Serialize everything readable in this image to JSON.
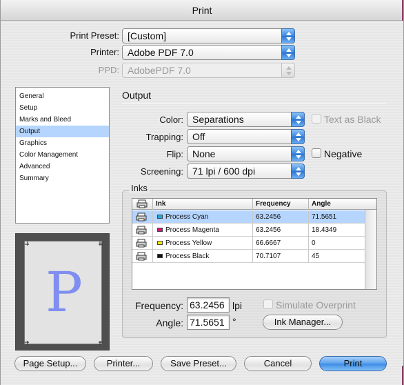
{
  "window": {
    "title": "Print"
  },
  "header": {
    "preset_label": "Print Preset:",
    "preset_value": "[Custom]",
    "printer_label": "Printer:",
    "printer_value": "Adobe PDF 7.0",
    "ppd_label": "PPD:",
    "ppd_value": "AdobePDF 7.0"
  },
  "sidebar": {
    "items": [
      {
        "label": "General"
      },
      {
        "label": "Setup"
      },
      {
        "label": "Marks and Bleed"
      },
      {
        "label": "Output",
        "selected": true
      },
      {
        "label": "Graphics"
      },
      {
        "label": "Color Management"
      },
      {
        "label": "Advanced"
      },
      {
        "label": "Summary"
      }
    ]
  },
  "preview": {
    "glyph": "P"
  },
  "output": {
    "section_title": "Output",
    "color_label": "Color:",
    "color_value": "Separations",
    "text_as_black_label": "Text as Black",
    "trapping_label": "Trapping:",
    "trapping_value": "Off",
    "flip_label": "Flip:",
    "flip_value": "None",
    "negative_label": "Negative",
    "screening_label": "Screening:",
    "screening_value": "71 lpi / 600 dpi"
  },
  "inks": {
    "section_title": "Inks",
    "columns": [
      "",
      "Ink",
      "Frequency",
      "Angle"
    ],
    "rows": [
      {
        "ink": "Process Cyan",
        "frequency": "63.2456",
        "angle": "71.5651",
        "color": "#19a9e0",
        "selected": true
      },
      {
        "ink": "Process Magenta",
        "frequency": "63.2456",
        "angle": "18.4349",
        "color": "#d6157f"
      },
      {
        "ink": "Process Yellow",
        "frequency": "66.6667",
        "angle": "0",
        "color": "#f5e812"
      },
      {
        "ink": "Process Black",
        "frequency": "70.7107",
        "angle": "45",
        "color": "#111111"
      }
    ],
    "frequency_label": "Frequency:",
    "frequency_value": "63.2456",
    "frequency_unit": "lpi",
    "angle_label": "Angle:",
    "angle_value": "71.5651",
    "angle_unit": "°",
    "simulate_overprint_label": "Simulate Overprint",
    "ink_manager_button": "Ink Manager..."
  },
  "footer": {
    "page_setup": "Page Setup...",
    "printer": "Printer...",
    "save_preset": "Save Preset...",
    "cancel": "Cancel",
    "print": "Print"
  }
}
